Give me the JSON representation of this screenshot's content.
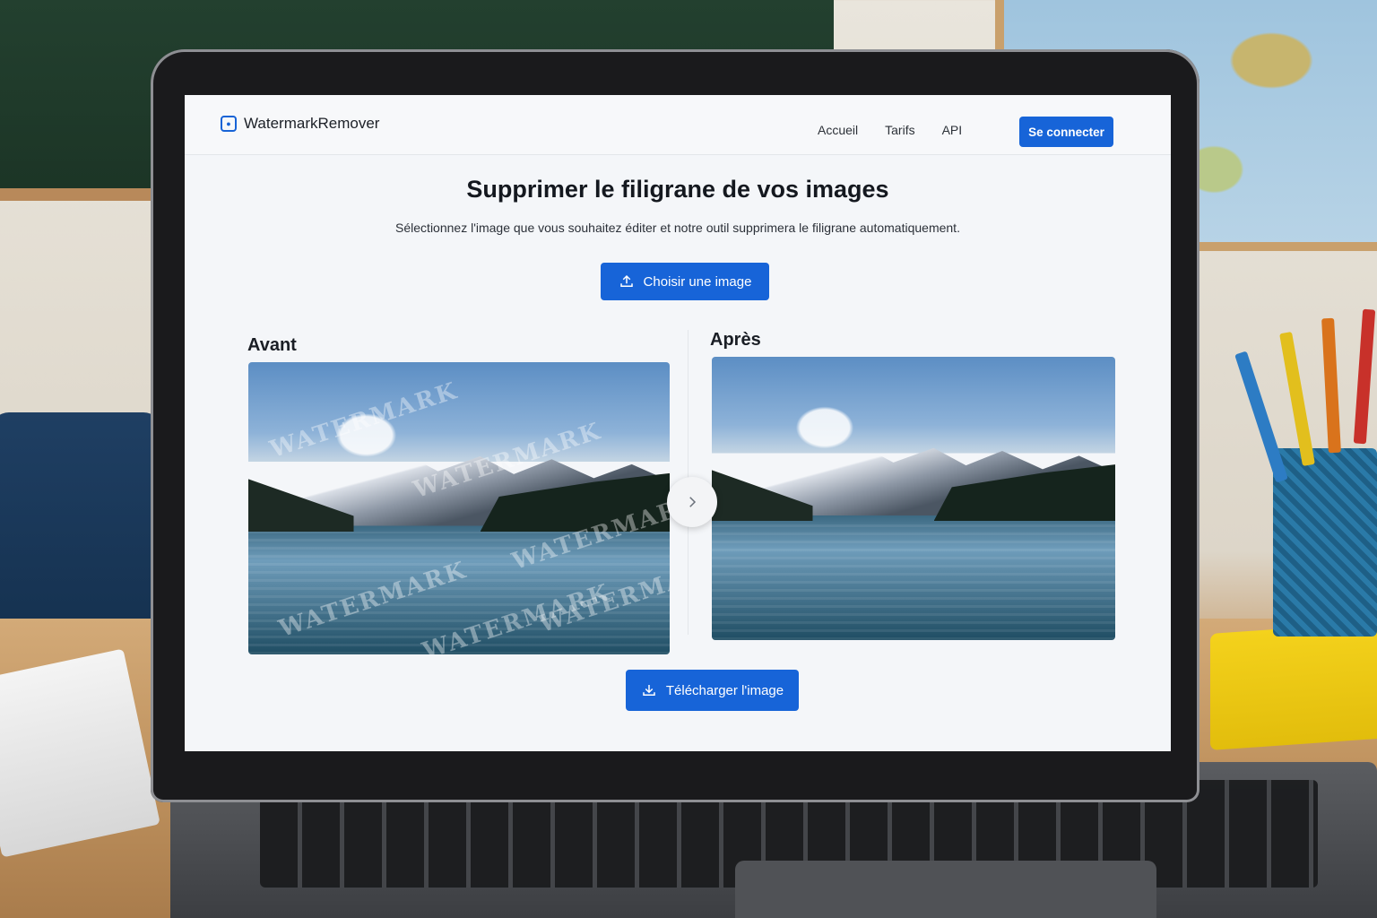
{
  "app": {
    "brand_name": "WatermarkRemover",
    "brand_icon": "watermark-drop-icon",
    "accent_color": "#1764d8"
  },
  "nav": {
    "links": [
      "Accueil",
      "Tarifs",
      "API"
    ],
    "login_label": "Se connecter"
  },
  "hero": {
    "title": "Supprimer le filigrane de vos images",
    "subtitle": "Sélectionnez l'image que vous souhaitez éditer et notre outil supprimera le filigrane automatiquement.",
    "choose_label": "Choisir une image",
    "choose_icon": "upload-icon"
  },
  "comparison": {
    "before_label": "Avant",
    "after_label": "Après",
    "watermark_texts": [
      "WATERMARK",
      "WATERMARK",
      "WATERMARK",
      "WATERMARK",
      "WATERMARK",
      "WATERMARK"
    ],
    "slider_icon": "chevron-right-icon"
  },
  "actions": {
    "download_label": "Télécharger l'image",
    "download_icon": "download-icon"
  }
}
